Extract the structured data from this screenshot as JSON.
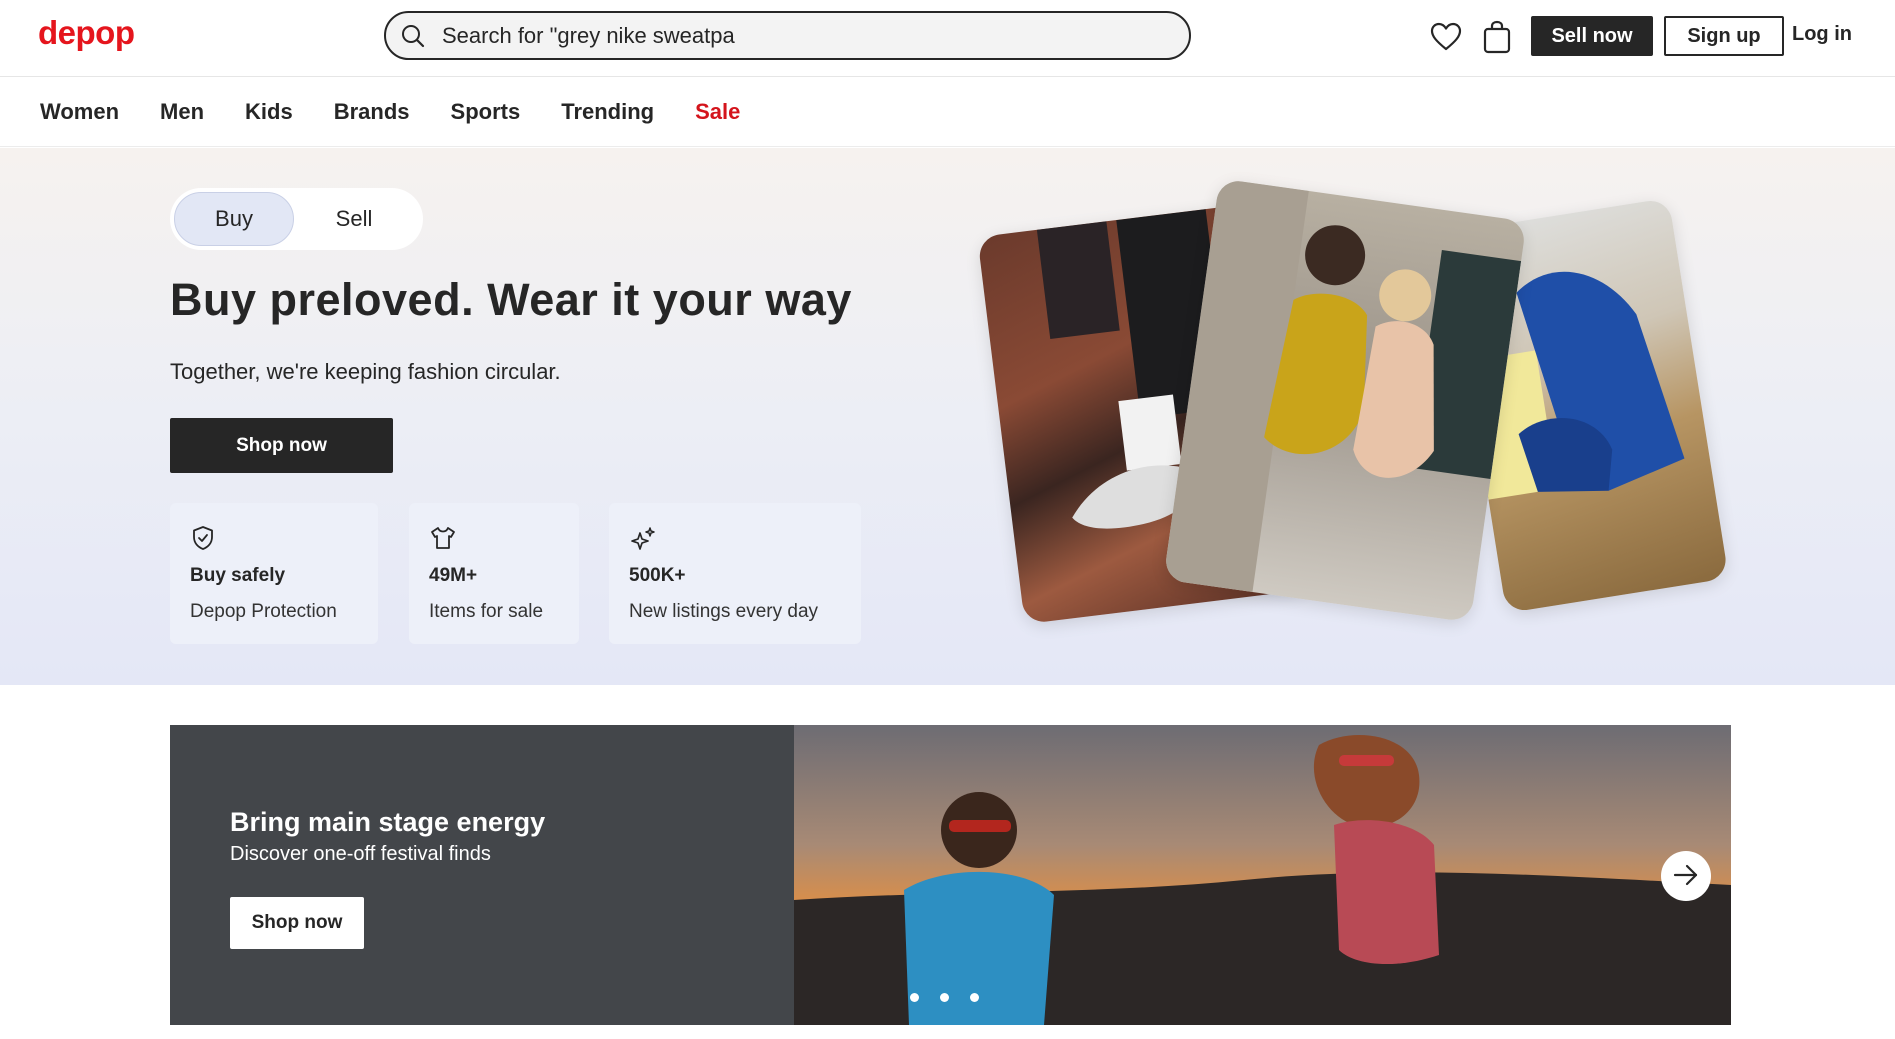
{
  "header": {
    "logo": "depop",
    "search_placeholder": "Search for \"grey nike sweatpa",
    "sell_label": "Sell now",
    "signup_label": "Sign up",
    "login_label": "Log in"
  },
  "nav": {
    "items": [
      {
        "label": "Women"
      },
      {
        "label": "Men"
      },
      {
        "label": "Kids"
      },
      {
        "label": "Brands"
      },
      {
        "label": "Sports"
      },
      {
        "label": "Trending"
      },
      {
        "label": "Sale"
      }
    ]
  },
  "hero": {
    "toggle": {
      "buy": "Buy",
      "sell": "Sell",
      "selected": "Buy"
    },
    "title": "Buy preloved. Wear it your way",
    "subtitle": "Together, we're keeping fashion circular.",
    "cta": "Shop now",
    "stats": [
      {
        "icon": "shield-check-icon",
        "title": "Buy safely",
        "desc": "Depop Protection"
      },
      {
        "icon": "tshirt-icon",
        "title": "49M+",
        "desc": "Items for sale"
      },
      {
        "icon": "sparkle-icon",
        "title": "500K+",
        "desc": "New listings every day"
      }
    ]
  },
  "banner": {
    "title": "Bring main stage energy",
    "subtitle": "Discover one-off festival finds",
    "cta": "Shop now"
  },
  "colors": {
    "brand": "#e5151d",
    "sale": "#d4141c",
    "dark": "#262626",
    "banner_bg": "#43464a"
  }
}
